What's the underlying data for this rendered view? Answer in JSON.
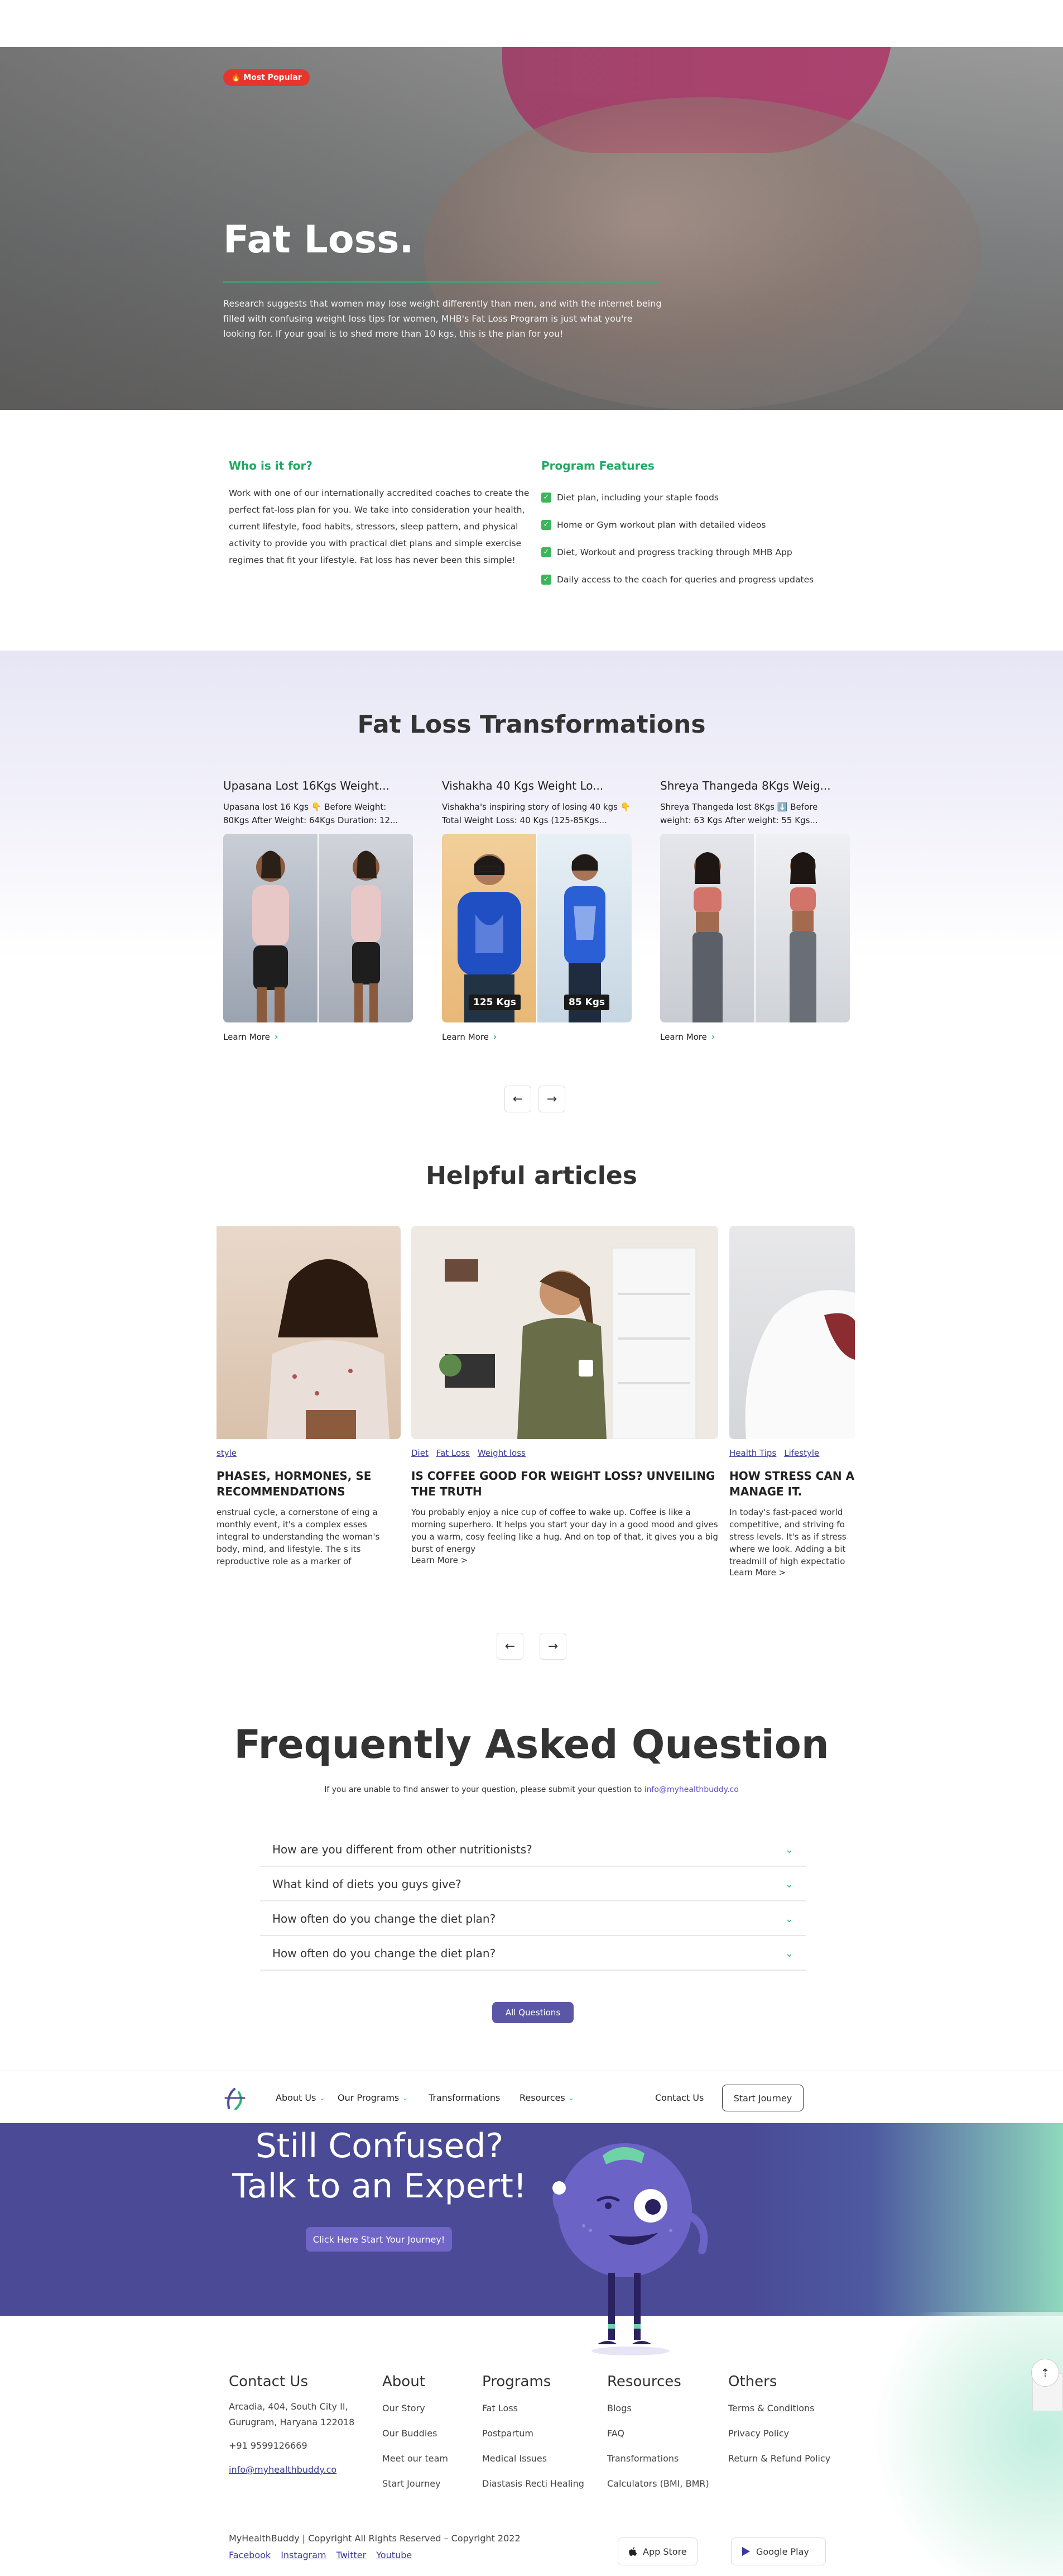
{
  "hero": {
    "badge": "🔥 Most Popular",
    "title": "Fat Loss.",
    "description": "Research suggests that women may lose weight differently than men, and with the internet being filled with confusing weight loss tips for women, MHB's Fat Loss Program is just what you're looking for. If your goal is to shed more than 10 kgs, this is the plan for you!"
  },
  "who": {
    "heading": "Who is it for?",
    "text": "Work with one of our internationally accredited coaches to create the perfect fat-loss plan for you. We take into consideration your health, current lifestyle, food habits, stressors, sleep pattern, and physical activity to provide you with practical diet plans and simple exercise regimes that fit your lifestyle. Fat loss has never been this simple!"
  },
  "features": {
    "heading": "Program Features",
    "items": [
      "Diet plan, including your staple foods",
      "Home or Gym workout plan with detailed videos",
      "Diet, Workout and progress tracking through MHB App",
      "Daily access to the coach for queries and progress updates"
    ]
  },
  "transformations": {
    "title": "Fat Loss Transformations",
    "cards": [
      {
        "title": "Upasana Lost 16Kgs Weight...",
        "desc": "Upasana lost 16 Kgs 👇 Before Weight: 80Kgs After Weight: 64Kgs Duration: 12...",
        "learn": "Learn More",
        "kg_before": "",
        "kg_after": ""
      },
      {
        "title": "Vishakha 40 Kgs Weight Lo...",
        "desc": "Vishakha's inspiring story of losing 40 kgs 👇 Total Weight Loss: 40 Kgs (125-85Kgs...",
        "learn": "Learn More",
        "kg_before": "125 Kgs",
        "kg_after": "85 Kgs"
      },
      {
        "title": "Shreya Thangeda 8Kgs Weig...",
        "desc": "Shreya Thangeda lost 8Kgs ⬇️ Before weight: 63 Kgs After weight: 55 Kgs...",
        "learn": "Learn More",
        "kg_before": "",
        "kg_after": ""
      }
    ]
  },
  "articles": {
    "title": "Helpful articles",
    "cards": [
      {
        "tags": [
          "style"
        ],
        "title": "PHASES, HORMONES, SE RECOMMENDATIONS",
        "desc": "enstrual cycle, a cornerstone of eing a monthly event, it's a complex esses integral to understanding the woman's body, mind, and lifestyle. The s its reproductive role as a marker of",
        "more": ""
      },
      {
        "tags": [
          "Diet",
          "Fat Loss",
          "Weight loss"
        ],
        "title": "IS COFFEE GOOD FOR WEIGHT LOSS? UNVEILING THE TRUTH",
        "desc": "You probably enjoy a nice cup of coffee to wake up. Coffee is like a morning superhero. It helps you start your day in a good mood and gives you a warm, cosy feeling like a hug. And on top of that, it gives you a big burst of energy",
        "more": "Learn More >"
      },
      {
        "tags": [
          "Health Tips",
          "Lifestyle"
        ],
        "title": "HOW STRESS CAN AF MANAGE IT.",
        "desc": "In today's fast-paced world competitive, and striving fo stress levels. It's as if stress where we look. Adding a bit treadmill of high expectatio",
        "more": "Learn More >"
      }
    ]
  },
  "faq": {
    "title": "Frequently Asked Question",
    "subtitle": "If you are unable to find answer to your question, please submit your question to",
    "email": "info@myhealthbuddy.co",
    "questions": [
      "How are you different from other nutritionists?",
      "What kind of diets you guys give?",
      "How often do you change the diet plan?",
      "How often do you change the diet plan?"
    ],
    "all_button": "All Questions"
  },
  "nav": {
    "about": "About Us",
    "programs": "Our Programs",
    "transformations": "Transformations",
    "resources": "Resources",
    "contact": "Contact Us",
    "start": "Start Journey"
  },
  "cta": {
    "line1": "Still Confused?",
    "line2": "Talk to an Expert!",
    "button": "Click Here Start Your Journey!"
  },
  "footer": {
    "contact": {
      "heading": "Contact Us",
      "address": "Arcadia, 404, South City II, Gurugram, Haryana 122018",
      "phone": "+91 9599126669",
      "email": "info@myhealthbuddy.co"
    },
    "about": {
      "heading": "About",
      "items": [
        "Our Story",
        "Our Buddies",
        "Meet our team",
        "Start Journey"
      ]
    },
    "programs": {
      "heading": "Programs",
      "items": [
        "Fat Loss",
        "Postpartum",
        "Medical Issues",
        "Diastasis Recti Healing"
      ]
    },
    "resources": {
      "heading": "Resources",
      "items": [
        "Blogs",
        "FAQ",
        "Transformations",
        "Calculators (BMI, BMR)"
      ]
    },
    "others": {
      "heading": "Others",
      "items": [
        "Terms & Conditions",
        "Privacy Policy",
        "Return & Refund Policy"
      ]
    },
    "copyright": "MyHealthBuddy | Copyright All Rights Reserved – Copyright 2022",
    "social": [
      "Facebook",
      "Instagram",
      "Twitter",
      "Youtube"
    ],
    "app_store": "App Store",
    "google_play": "Google Play"
  },
  "colors": {
    "accent_green": "#2bb673",
    "brand_purple": "#4b4a96",
    "badge_red": "#e8352b"
  }
}
